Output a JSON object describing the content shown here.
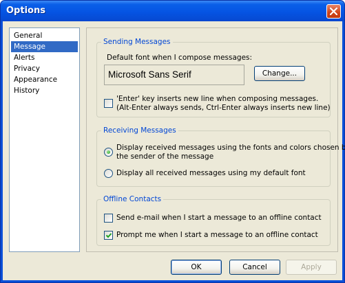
{
  "window": {
    "title": "Options"
  },
  "nav": {
    "items": [
      {
        "label": "General",
        "selected": false
      },
      {
        "label": "Message",
        "selected": true
      },
      {
        "label": "Alerts",
        "selected": false
      },
      {
        "label": "Privacy",
        "selected": false
      },
      {
        "label": "Appearance",
        "selected": false
      },
      {
        "label": "History",
        "selected": false
      }
    ]
  },
  "sending": {
    "title": "Sending Messages",
    "font_prompt": "Default font when I compose messages:",
    "font_value": "Microsoft Sans Serif",
    "change_label": "Change...",
    "enter_option": {
      "line1": "'Enter' key inserts new line when composing messages.",
      "line2": "(Alt-Enter always sends, Ctrl-Enter always inserts new line)",
      "checked": false
    }
  },
  "receiving": {
    "title": "Receiving Messages",
    "option_fonts": {
      "line1": "Display received messages using the fonts and colors chosen by",
      "line2": "the sender of the message",
      "selected": true
    },
    "option_default": {
      "label": "Display all received messages using my default font",
      "selected": false
    }
  },
  "offline": {
    "title": "Offline Contacts",
    "send_email": {
      "label": "Send e-mail when I start a message to an offline contact",
      "checked": false
    },
    "prompt_me": {
      "label": "Prompt me when I start a message to an offline contact",
      "checked": true
    }
  },
  "buttons": {
    "ok": "OK",
    "cancel": "Cancel",
    "apply": "Apply"
  },
  "colors": {
    "titlebar": "#0554e3",
    "accent_group_title": "#0046d5",
    "selection": "#316ac5",
    "dialog_bg": "#ece9d8"
  },
  "icons": {
    "close": "close-icon",
    "check": "checkmark-icon"
  }
}
